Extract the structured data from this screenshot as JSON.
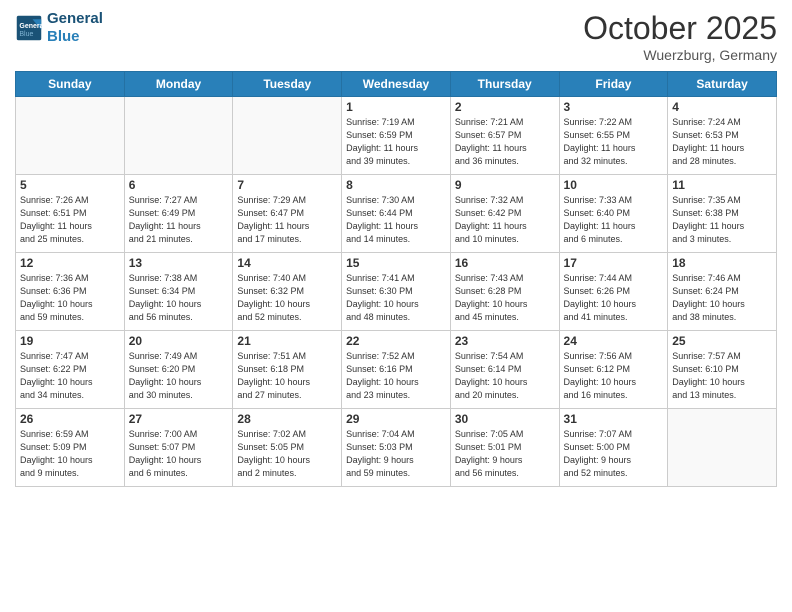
{
  "header": {
    "logo_line1": "General",
    "logo_line2": "Blue",
    "title": "October 2025",
    "location": "Wuerzburg, Germany"
  },
  "days_of_week": [
    "Sunday",
    "Monday",
    "Tuesday",
    "Wednesday",
    "Thursday",
    "Friday",
    "Saturday"
  ],
  "weeks": [
    [
      {
        "day": "",
        "info": ""
      },
      {
        "day": "",
        "info": ""
      },
      {
        "day": "",
        "info": ""
      },
      {
        "day": "1",
        "info": "Sunrise: 7:19 AM\nSunset: 6:59 PM\nDaylight: 11 hours\nand 39 minutes."
      },
      {
        "day": "2",
        "info": "Sunrise: 7:21 AM\nSunset: 6:57 PM\nDaylight: 11 hours\nand 36 minutes."
      },
      {
        "day": "3",
        "info": "Sunrise: 7:22 AM\nSunset: 6:55 PM\nDaylight: 11 hours\nand 32 minutes."
      },
      {
        "day": "4",
        "info": "Sunrise: 7:24 AM\nSunset: 6:53 PM\nDaylight: 11 hours\nand 28 minutes."
      }
    ],
    [
      {
        "day": "5",
        "info": "Sunrise: 7:26 AM\nSunset: 6:51 PM\nDaylight: 11 hours\nand 25 minutes."
      },
      {
        "day": "6",
        "info": "Sunrise: 7:27 AM\nSunset: 6:49 PM\nDaylight: 11 hours\nand 21 minutes."
      },
      {
        "day": "7",
        "info": "Sunrise: 7:29 AM\nSunset: 6:47 PM\nDaylight: 11 hours\nand 17 minutes."
      },
      {
        "day": "8",
        "info": "Sunrise: 7:30 AM\nSunset: 6:44 PM\nDaylight: 11 hours\nand 14 minutes."
      },
      {
        "day": "9",
        "info": "Sunrise: 7:32 AM\nSunset: 6:42 PM\nDaylight: 11 hours\nand 10 minutes."
      },
      {
        "day": "10",
        "info": "Sunrise: 7:33 AM\nSunset: 6:40 PM\nDaylight: 11 hours\nand 6 minutes."
      },
      {
        "day": "11",
        "info": "Sunrise: 7:35 AM\nSunset: 6:38 PM\nDaylight: 11 hours\nand 3 minutes."
      }
    ],
    [
      {
        "day": "12",
        "info": "Sunrise: 7:36 AM\nSunset: 6:36 PM\nDaylight: 10 hours\nand 59 minutes."
      },
      {
        "day": "13",
        "info": "Sunrise: 7:38 AM\nSunset: 6:34 PM\nDaylight: 10 hours\nand 56 minutes."
      },
      {
        "day": "14",
        "info": "Sunrise: 7:40 AM\nSunset: 6:32 PM\nDaylight: 10 hours\nand 52 minutes."
      },
      {
        "day": "15",
        "info": "Sunrise: 7:41 AM\nSunset: 6:30 PM\nDaylight: 10 hours\nand 48 minutes."
      },
      {
        "day": "16",
        "info": "Sunrise: 7:43 AM\nSunset: 6:28 PM\nDaylight: 10 hours\nand 45 minutes."
      },
      {
        "day": "17",
        "info": "Sunrise: 7:44 AM\nSunset: 6:26 PM\nDaylight: 10 hours\nand 41 minutes."
      },
      {
        "day": "18",
        "info": "Sunrise: 7:46 AM\nSunset: 6:24 PM\nDaylight: 10 hours\nand 38 minutes."
      }
    ],
    [
      {
        "day": "19",
        "info": "Sunrise: 7:47 AM\nSunset: 6:22 PM\nDaylight: 10 hours\nand 34 minutes."
      },
      {
        "day": "20",
        "info": "Sunrise: 7:49 AM\nSunset: 6:20 PM\nDaylight: 10 hours\nand 30 minutes."
      },
      {
        "day": "21",
        "info": "Sunrise: 7:51 AM\nSunset: 6:18 PM\nDaylight: 10 hours\nand 27 minutes."
      },
      {
        "day": "22",
        "info": "Sunrise: 7:52 AM\nSunset: 6:16 PM\nDaylight: 10 hours\nand 23 minutes."
      },
      {
        "day": "23",
        "info": "Sunrise: 7:54 AM\nSunset: 6:14 PM\nDaylight: 10 hours\nand 20 minutes."
      },
      {
        "day": "24",
        "info": "Sunrise: 7:56 AM\nSunset: 6:12 PM\nDaylight: 10 hours\nand 16 minutes."
      },
      {
        "day": "25",
        "info": "Sunrise: 7:57 AM\nSunset: 6:10 PM\nDaylight: 10 hours\nand 13 minutes."
      }
    ],
    [
      {
        "day": "26",
        "info": "Sunrise: 6:59 AM\nSunset: 5:09 PM\nDaylight: 10 hours\nand 9 minutes."
      },
      {
        "day": "27",
        "info": "Sunrise: 7:00 AM\nSunset: 5:07 PM\nDaylight: 10 hours\nand 6 minutes."
      },
      {
        "day": "28",
        "info": "Sunrise: 7:02 AM\nSunset: 5:05 PM\nDaylight: 10 hours\nand 2 minutes."
      },
      {
        "day": "29",
        "info": "Sunrise: 7:04 AM\nSunset: 5:03 PM\nDaylight: 9 hours\nand 59 minutes."
      },
      {
        "day": "30",
        "info": "Sunrise: 7:05 AM\nSunset: 5:01 PM\nDaylight: 9 hours\nand 56 minutes."
      },
      {
        "day": "31",
        "info": "Sunrise: 7:07 AM\nSunset: 5:00 PM\nDaylight: 9 hours\nand 52 minutes."
      },
      {
        "day": "",
        "info": ""
      }
    ]
  ]
}
